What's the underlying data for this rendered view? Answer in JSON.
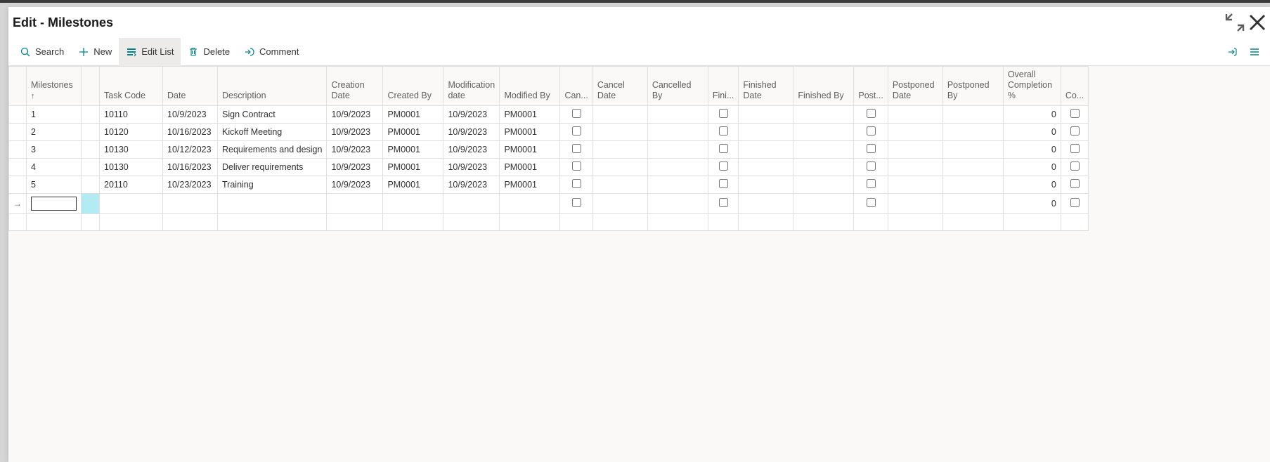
{
  "title": "Edit - Milestones",
  "toolbar": {
    "search": "Search",
    "new": "New",
    "editList": "Edit List",
    "delete": "Delete",
    "comment": "Comment"
  },
  "columns": {
    "milestones": "Milestones",
    "sortIndicator": "↑",
    "taskCode": "Task Code",
    "date": "Date",
    "description": "Description",
    "creationDate": "Creation Date",
    "createdBy": "Created By",
    "modificationDate": "Modification date",
    "modifiedBy": "Modified By",
    "can": "Can...",
    "cancelDate": "Cancel Date",
    "cancelledBy": "Cancelled By",
    "fini": "Fini...",
    "finishedDate": "Finished Date",
    "finishedBy": "Finished By",
    "post": "Post...",
    "postponedDate": "Postponed Date",
    "postponedBy": "Postponed By",
    "overallCompletion": "Overall Completion %",
    "co": "Co..."
  },
  "rows": [
    {
      "milestone": "1",
      "taskCode": "10110",
      "date": "10/9/2023",
      "description": "Sign Contract",
      "creationDate": "10/9/2023",
      "createdBy": "PM0001",
      "modificationDate": "10/9/2023",
      "modifiedBy": "PM0001",
      "can": false,
      "cancelDate": "",
      "cancelledBy": "",
      "fini": false,
      "finishedDate": "",
      "finishedBy": "",
      "post": false,
      "postponedDate": "",
      "postponedBy": "",
      "completion": "0",
      "co": false
    },
    {
      "milestone": "2",
      "taskCode": "10120",
      "date": "10/16/2023",
      "description": "Kickoff Meeting",
      "creationDate": "10/9/2023",
      "createdBy": "PM0001",
      "modificationDate": "10/9/2023",
      "modifiedBy": "PM0001",
      "can": false,
      "cancelDate": "",
      "cancelledBy": "",
      "fini": false,
      "finishedDate": "",
      "finishedBy": "",
      "post": false,
      "postponedDate": "",
      "postponedBy": "",
      "completion": "0",
      "co": false
    },
    {
      "milestone": "3",
      "taskCode": "10130",
      "date": "10/12/2023",
      "description": "Requirements and design",
      "creationDate": "10/9/2023",
      "createdBy": "PM0001",
      "modificationDate": "10/9/2023",
      "modifiedBy": "PM0001",
      "can": false,
      "cancelDate": "",
      "cancelledBy": "",
      "fini": false,
      "finishedDate": "",
      "finishedBy": "",
      "post": false,
      "postponedDate": "",
      "postponedBy": "",
      "completion": "0",
      "co": false
    },
    {
      "milestone": "4",
      "taskCode": "10130",
      "date": "10/16/2023",
      "description": "Deliver requirements",
      "creationDate": "10/9/2023",
      "createdBy": "PM0001",
      "modificationDate": "10/9/2023",
      "modifiedBy": "PM0001",
      "can": false,
      "cancelDate": "",
      "cancelledBy": "",
      "fini": false,
      "finishedDate": "",
      "finishedBy": "",
      "post": false,
      "postponedDate": "",
      "postponedBy": "",
      "completion": "0",
      "co": false
    },
    {
      "milestone": "5",
      "taskCode": "20110",
      "date": "10/23/2023",
      "description": "Training",
      "creationDate": "10/9/2023",
      "createdBy": "PM0001",
      "modificationDate": "10/9/2023",
      "modifiedBy": "PM0001",
      "can": false,
      "cancelDate": "",
      "cancelledBy": "",
      "fini": false,
      "finishedDate": "",
      "finishedBy": "",
      "post": false,
      "postponedDate": "",
      "postponedBy": "",
      "completion": "0",
      "co": false
    }
  ],
  "newRow": {
    "completion": "0"
  },
  "blankRow": {}
}
